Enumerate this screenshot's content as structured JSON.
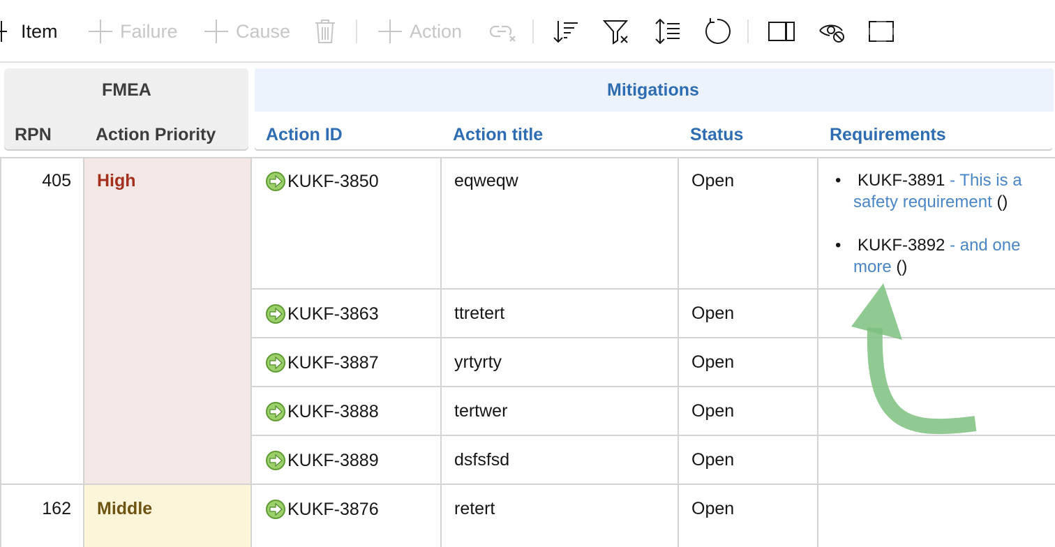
{
  "toolbar": {
    "add_item": "Item",
    "add_failure": "Failure",
    "add_cause": "Cause",
    "add_action": "Action"
  },
  "header": {
    "fmea_group": "FMEA",
    "mitigations_group": "Mitigations",
    "columns": {
      "rpn": "RPN",
      "action_priority": "Action Priority",
      "action_id": "Action ID",
      "action_title": "Action title",
      "status": "Status",
      "requirements": "Requirements"
    }
  },
  "groups": [
    {
      "rpn": "405",
      "priority": "High",
      "priority_color": "#a3301c",
      "priority_bg": "#f3e8e5",
      "actions": [
        {
          "id": "KUKF-3850",
          "title": "eqweqw",
          "status": "Open",
          "requirements": [
            {
              "id": "KUKF-3891",
              "link_text": "- This is a",
              "link_text_2": "safety requirement",
              "suffix": "()"
            },
            {
              "id": "KUKF-3892",
              "link_text": "- and one",
              "link_text_2": "more",
              "suffix": "()"
            }
          ]
        },
        {
          "id": "KUKF-3863",
          "title": "ttretert",
          "status": "Open"
        },
        {
          "id": "KUKF-3887",
          "title": "yrtyrty",
          "status": "Open"
        },
        {
          "id": "KUKF-3888",
          "title": "tertwer",
          "status": "Open"
        },
        {
          "id": "KUKF-3889",
          "title": "dsfsfsd",
          "status": "Open"
        }
      ]
    },
    {
      "rpn": "162",
      "priority": "Middle",
      "priority_color": "#6e5413",
      "priority_bg": "#fcf5d9",
      "actions": [
        {
          "id": "KUKF-3876",
          "title": "retert",
          "status": "Open"
        }
      ]
    }
  ],
  "colors": {
    "accent_blue": "#2f6db3",
    "link_blue": "#4a86c6",
    "action_icon_green": "#6cab3a",
    "annotation_arrow": "#7cc07f"
  },
  "icons": {
    "add": "plus-icon",
    "delete": "trash-icon",
    "unlink": "unlink-icon",
    "sort": "sort-icon",
    "filter_clear": "filter-clear-icon",
    "row_height": "row-height-icon",
    "refresh": "refresh-icon",
    "split_view": "split-view-icon",
    "hide": "eye-hide-icon",
    "fullscreen": "fullscreen-icon",
    "action": "action-arrow-icon"
  }
}
